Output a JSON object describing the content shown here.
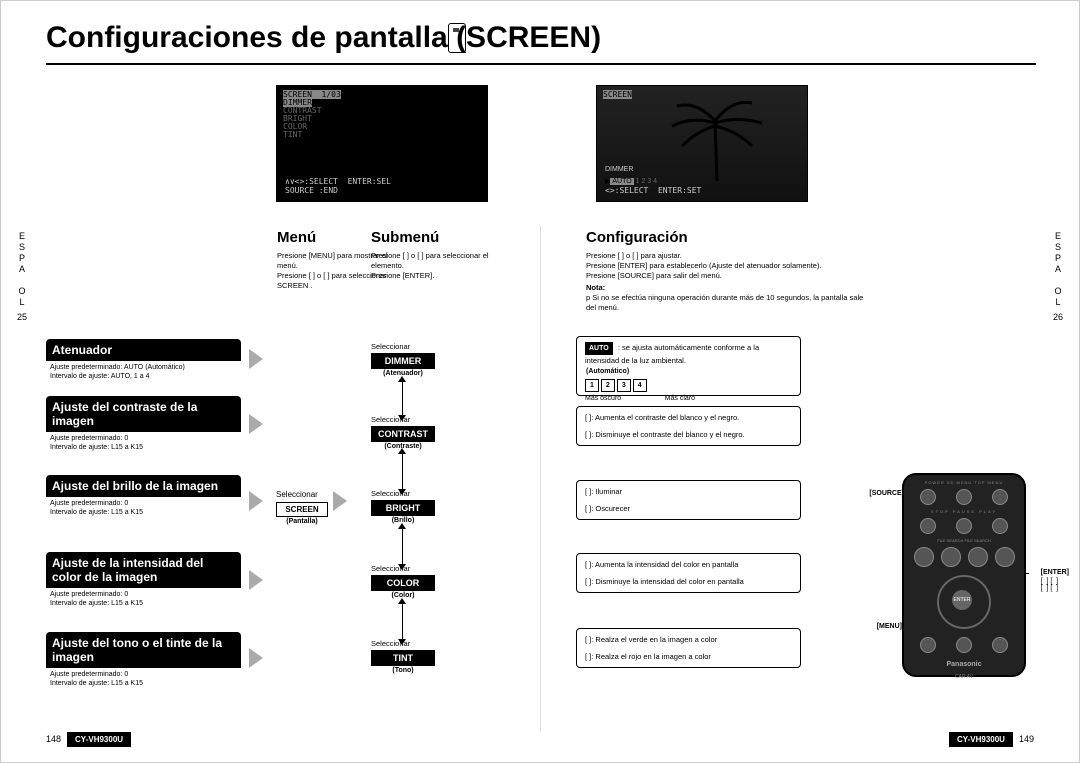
{
  "title": "Configuraciones de pantalla (SCREEN)",
  "espanol": {
    "letters": [
      "E",
      "S",
      "P",
      "A",
      " ",
      "O",
      "L"
    ],
    "left_num": "25",
    "right_num": "26"
  },
  "columns": {
    "menu": "Menú",
    "submenu": "Submenú",
    "config": "Configuración"
  },
  "menu_text": "Presione [MENU] para mostrar el menú.\nPresione [ ] o [ ] para seleccionar SCREEN .",
  "submenu_text": "Presione [ ] o [ ] para seleccionar el elemento.\nPresione [ENTER].",
  "config_text": "Presione [ ] o [ ] para ajustar.\nPresione [ENTER] para establecerlo (Ajuste del atenuador solamente).\nPresione [SOURCE] para salir del menú.",
  "config_note_label": "Nota:",
  "config_note": "p Si no se efectúa ninguna operación durante más de 10 segundos, la pantalla sale del menú.",
  "screenshot1": {
    "lines": [
      "SCREEN  1/03",
      "DIMMER",
      "CONTRAST",
      "BRIGHT",
      "COLOR",
      "TINT"
    ],
    "foot": "∧∨<>:SELECT  ENTER:SEL\nSOURCE :END"
  },
  "screenshot2": {
    "top": "SCREEN",
    "dimmer": "DIMMER",
    "auto": "AUTO",
    "foot": "<>:SELECT  ENTER:SET"
  },
  "features": [
    {
      "title": "Atenuador",
      "body": "Ajuste predeterminado: AUTO (Automático)\nIntervalo de ajuste: AUTO, 1 a 4"
    },
    {
      "title": "Ajuste del contraste de la imagen",
      "body": "Ajuste predeterminado: 0\nIntervalo de ajuste: L15 a K15"
    },
    {
      "title": "Ajuste del brillo de la imagen",
      "body": "Ajuste predeterminado: 0\nIntervalo de ajuste: L15 a K15"
    },
    {
      "title": "Ajuste de la intensidad del color de la imagen",
      "body": "Ajuste predeterminado: 0\nIntervalo de ajuste: L15 a K15"
    },
    {
      "title": "Ajuste del tono o el tinte de la imagen",
      "body": "Ajuste predeterminado: 0\nIntervalo de ajuste: L15 a K15"
    }
  ],
  "screen_select": "Seleccionar",
  "screen_btn": {
    "label": "SCREEN",
    "sub": "(Pantalla)"
  },
  "sub_items": [
    {
      "sel": "Seleccionar",
      "label": "DIMMER",
      "sub": "(Atenuador)"
    },
    {
      "sel": "Seleccionar",
      "label": "CONTRAST",
      "sub": "(Contraste)"
    },
    {
      "sel": "Seleccionar",
      "label": "BRIGHT",
      "sub": "(Brillo)"
    },
    {
      "sel": "Seleccionar",
      "label": "COLOR",
      "sub": "(Color)"
    },
    {
      "sel": "Seleccionar",
      "label": "TINT",
      "sub": "(Tono)"
    }
  ],
  "config_blocks": {
    "dimmer": {
      "auto": "AUTO",
      "auto_sub": "(Automático)",
      "desc": ": se ajusta automáticamente conforme a la intensidad de la luz ambiental.",
      "nums": [
        "1",
        "2",
        "3",
        "4"
      ],
      "dark": "Más oscuro",
      "light": "Más claro"
    },
    "contrast": {
      "up": "[  ]: Aumenta el contraste del blanco y el negro.",
      "down": "[  ]: Disminuye el contraste del blanco y el negro."
    },
    "bright": {
      "up": "[  ]: Iluminar",
      "down": "[  ]: Oscurecer"
    },
    "color": {
      "up": "[  ]: Aumenta la intensidad del color en pantalla",
      "down": "[  ]: Disminuye la intensidad del color en pantalla"
    },
    "tint": {
      "up": "[  ]: Realza el verde en la imagen a color",
      "down": "[  ]: Realza el rojo en la imagen a color"
    }
  },
  "remote": {
    "source": "[SOURCE]",
    "enter": "[ENTER]",
    "enter_arrows": "[  ] [  ]\n[  ] [  ]",
    "menu": "[MENU]",
    "brand": "Panasonic",
    "model": "CAR AV",
    "center": "ENTER",
    "top_labels": "POWER  SD MENU  TOP MENU",
    "row2_labels": "STOP   PAUSE   PLAY",
    "row3_labels": "FILE SEARCH       FILE SEARCH"
  },
  "page_left": "148",
  "page_right": "149",
  "model": "CY-VH9300U"
}
